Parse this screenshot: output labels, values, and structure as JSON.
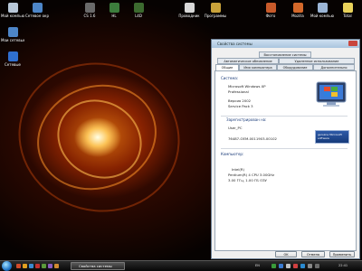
{
  "desktop": {
    "left_icons": [
      {
        "label": "Мой компьютер",
        "color": "#b8c7d8"
      },
      {
        "label": "Сетевое окружение",
        "color": "#4d86c8"
      },
      {
        "label": "Мои сетевые",
        "color": "#4d86c8"
      },
      {
        "label": "Сетевые",
        "color": "#2f6fd0"
      }
    ],
    "top_icons": [
      {
        "label": "CS 1.6",
        "color": "#6a6a6a"
      },
      {
        "label": "HL",
        "color": "#3c7d3c"
      },
      {
        "label": "L4D",
        "color": "#3c6a2f"
      },
      {
        "label": "Проводник",
        "color": "#d8d8d8"
      },
      {
        "label": "Программы",
        "color": "#c9a23a"
      },
      {
        "label": "Фото",
        "color": "#c85a2a"
      },
      {
        "label": "Mozilla",
        "color": "#d3682a"
      },
      {
        "label": "Мой компьютер",
        "color": "#9bb5d6"
      },
      {
        "label": "Total",
        "color": "#e8d25a"
      }
    ]
  },
  "window": {
    "title": "Свойства системы",
    "top_tabs": [
      "Восстановление системы",
      "Автоматическое обновление",
      "Удаленное использование"
    ],
    "bottom_tabs": [
      "Общие",
      "Имя компьютера",
      "Оборудование",
      "Дополнительно"
    ],
    "system_group": "Система:",
    "system_lines": [
      "Microsoft Windows XP",
      "Professional",
      "Версия 2002",
      "Service Pack 3"
    ],
    "registered_group": "Зарегистрирован на:",
    "registered_name": "User_PC",
    "product_key": "76487-OEM-0011903-00102",
    "genuine_badge": "genuine Microsoft software",
    "computer_group": "Компьютер:",
    "computer_lines": [
      "Intel(R)",
      "Pentium(R) 4 CPU 3.00GHz",
      "3.00 ГГц, 1.00 ГБ ОЗУ"
    ],
    "buttons": {
      "ok": "OK",
      "cancel": "Отмена",
      "apply": "Применить"
    }
  },
  "taskbar": {
    "task_label": "Свойства системы",
    "language": "EN",
    "time": "22:41"
  }
}
